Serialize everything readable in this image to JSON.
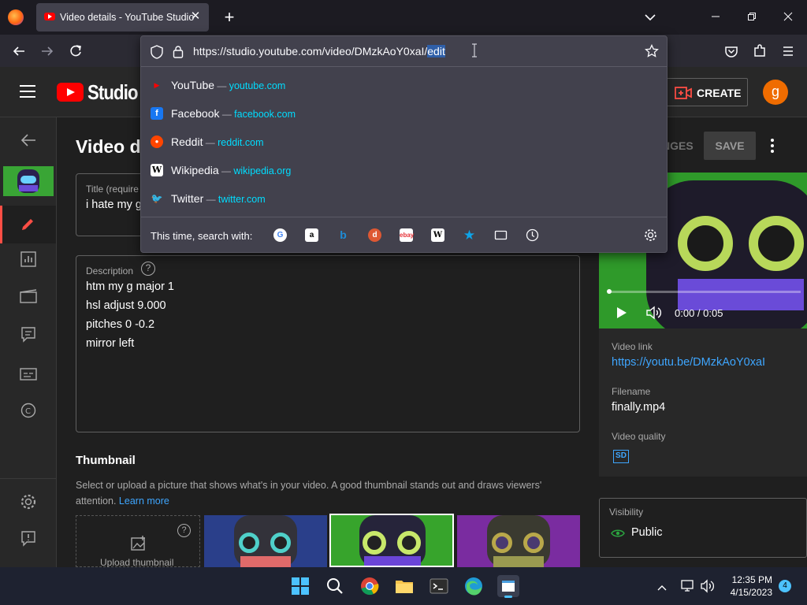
{
  "browser": {
    "tab_title": "Video details - YouTube Studio",
    "url_prefix": "https://studio.youtube.com/video/DMzkAoY0xaI/",
    "url_selected": "edit",
    "suggestions": [
      {
        "name": "YouTube",
        "domain": "youtube.com",
        "icon": "youtube-icon",
        "color": "#ff0000"
      },
      {
        "name": "Facebook",
        "domain": "facebook.com",
        "icon": "facebook-icon",
        "color": "#1877f2"
      },
      {
        "name": "Reddit",
        "domain": "reddit.com",
        "icon": "reddit-icon",
        "color": "#ff4500"
      },
      {
        "name": "Wikipedia",
        "domain": "wikipedia.org",
        "icon": "wikipedia-icon",
        "color": "#ffffff"
      },
      {
        "name": "Twitter",
        "domain": "twitter.com",
        "icon": "twitter-icon",
        "color": "#1d9bf0"
      }
    ],
    "separator": "—",
    "search_with_label": "This time, search with:",
    "engines": [
      "google-icon",
      "amazon-icon",
      "bing-icon",
      "duckduckgo-icon",
      "ebay-icon",
      "wikipedia-icon",
      "bookmarks-star-icon",
      "tabs-icon",
      "history-icon"
    ]
  },
  "studio": {
    "logo_text": "Studio",
    "create_label": "CREATE",
    "avatar_letter": "g",
    "page_title": "Video d",
    "changes_label": "NGES",
    "save_label": "SAVE",
    "title_label": "Title (require",
    "title_value": "i hate my g",
    "description_label": "Description",
    "description_lines": [
      "htm my g major 1",
      "hsl adjust 9.000",
      "pitches 0 -0.2",
      "mirror left"
    ],
    "thumbnail_heading": "Thumbnail",
    "thumbnail_help": "Select or upload a picture that shows what's in your video. A good thumbnail stands out and draws viewers' attention.",
    "learn_more": "Learn more",
    "upload_thumbnail": "Upload thumbnail",
    "player_time": "0:00 / 0:05",
    "video_link_label": "Video link",
    "video_link": "https://youtu.be/DMzkAoY0xaI",
    "filename_label": "Filename",
    "filename": "finally.mp4",
    "quality_label": "Video quality",
    "quality_badge": "SD",
    "visibility_label": "Visibility",
    "visibility_value": "Public"
  },
  "taskbar": {
    "time": "12:35 PM",
    "date": "4/15/2023",
    "notification_count": "4"
  },
  "colors": {
    "accent_red": "#ff0000",
    "link_blue": "#3ea6ff",
    "avatar_orange": "#ef6c00"
  }
}
